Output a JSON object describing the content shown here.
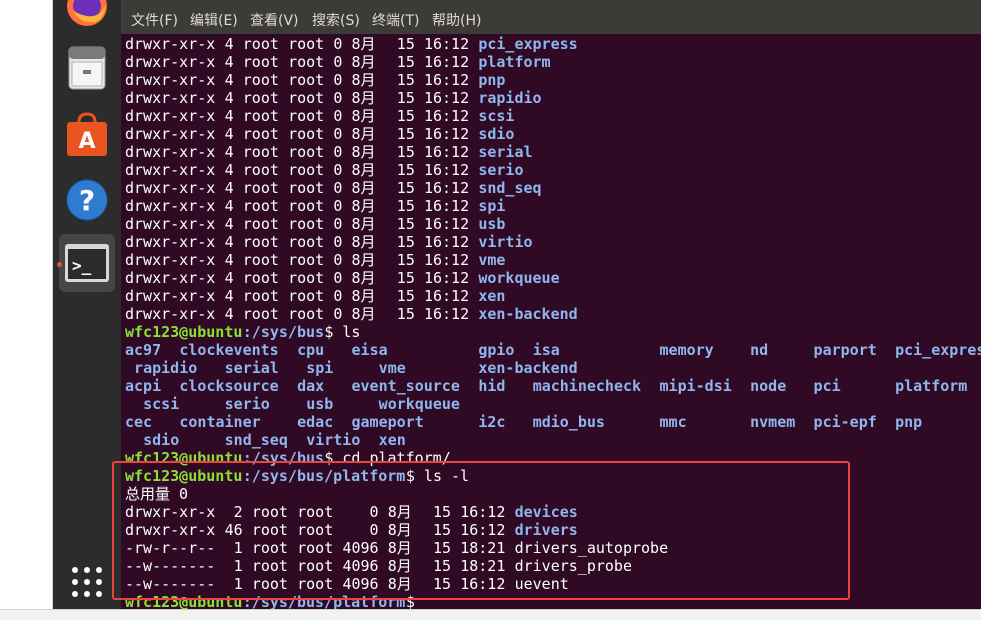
{
  "menu": [
    "文件(F)",
    "编辑(E)",
    "查看(V)",
    "搜索(S)",
    "终端(T)",
    "帮助(H)"
  ],
  "dock": {
    "items": [
      {
        "icon": "firefox-icon"
      },
      {
        "icon": "files-icon"
      },
      {
        "icon": "software-icon",
        "glyph": "A"
      },
      {
        "icon": "help-icon",
        "glyph": "?"
      },
      {
        "icon": "terminal-icon",
        "glyph": ">_"
      },
      {
        "icon": "show-apps-icon"
      }
    ]
  },
  "listing1": {
    "perm": "drwxr-xr-x",
    "links": "4",
    "owner": "root",
    "group": "root",
    "size": "0",
    "month": "8月",
    "day": "15",
    "time": "16:12",
    "names": [
      "pci_express",
      "platform",
      "pnp",
      "rapidio",
      "scsi",
      "sdio",
      "serial",
      "serio",
      "snd_seq",
      "spi",
      "usb",
      "virtio",
      "vme",
      "workqueue",
      "xen",
      "xen-backend"
    ]
  },
  "prompt1": {
    "user": "wfc123@ubuntu",
    "path": ":/sys/bus",
    "cmd": "$ ls"
  },
  "ls_grid": [
    [
      "ac97",
      "clockevents",
      "cpu",
      "eisa",
      "gpio",
      "isa",
      "memory",
      "nd",
      "parport",
      "pci_expres"
    ],
    [
      "rapidio",
      "serial",
      "spi",
      "vme",
      "xen-backend"
    ],
    [
      "acpi",
      "clocksource",
      "dax",
      "event_source",
      "hid",
      "machinecheck",
      "mipi-dsi",
      "node",
      "pci",
      "platform"
    ],
    [
      "scsi",
      "serio",
      "usb",
      "workqueue"
    ],
    [
      "cec",
      "container",
      "edac",
      "gameport",
      "i2c",
      "mdio_bus",
      "mmc",
      "nvmem",
      "pci-epf",
      "pnp"
    ],
    [
      "sdio",
      "snd_seq",
      "virtio",
      "xen"
    ]
  ],
  "prompt2": {
    "user": "wfc123@ubuntu",
    "path": ":/sys/bus",
    "cmd": "$ cd platform/"
  },
  "prompt3": {
    "user": "wfc123@ubuntu",
    "path": ":/sys/bus/platform",
    "cmd": "$ ls -l"
  },
  "total_line": "总用量 0",
  "listing2": [
    {
      "perm": "drwxr-xr-x",
      "links": " 2",
      "owner": "root",
      "group": "root",
      "size": "   0",
      "month": "8月",
      "day": "15",
      "time": "16:12",
      "name": "devices",
      "dir": true
    },
    {
      "perm": "drwxr-xr-x",
      "links": "46",
      "owner": "root",
      "group": "root",
      "size": "   0",
      "month": "8月",
      "day": "15",
      "time": "16:12",
      "name": "drivers",
      "dir": true
    },
    {
      "perm": "-rw-r--r--",
      "links": " 1",
      "owner": "root",
      "group": "root",
      "size": "4096",
      "month": "8月",
      "day": "15",
      "time": "18:21",
      "name": "drivers_autoprobe",
      "dir": false
    },
    {
      "perm": "--w-------",
      "links": " 1",
      "owner": "root",
      "group": "root",
      "size": "4096",
      "month": "8月",
      "day": "15",
      "time": "18:21",
      "name": "drivers_probe",
      "dir": false
    },
    {
      "perm": "--w-------",
      "links": " 1",
      "owner": "root",
      "group": "root",
      "size": "4096",
      "month": "8月",
      "day": "15",
      "time": "16:12",
      "name": "uevent",
      "dir": false
    }
  ],
  "prompt4": {
    "user": "wfc123@ubuntu",
    "path": ":/sys/bus/platform",
    "cmd": "$"
  },
  "colors": {
    "terminal_bg": "#300a24",
    "dir_blue": "#8fb6ee",
    "prompt_green": "#8ae234",
    "highlight_red": "#e8453c"
  }
}
